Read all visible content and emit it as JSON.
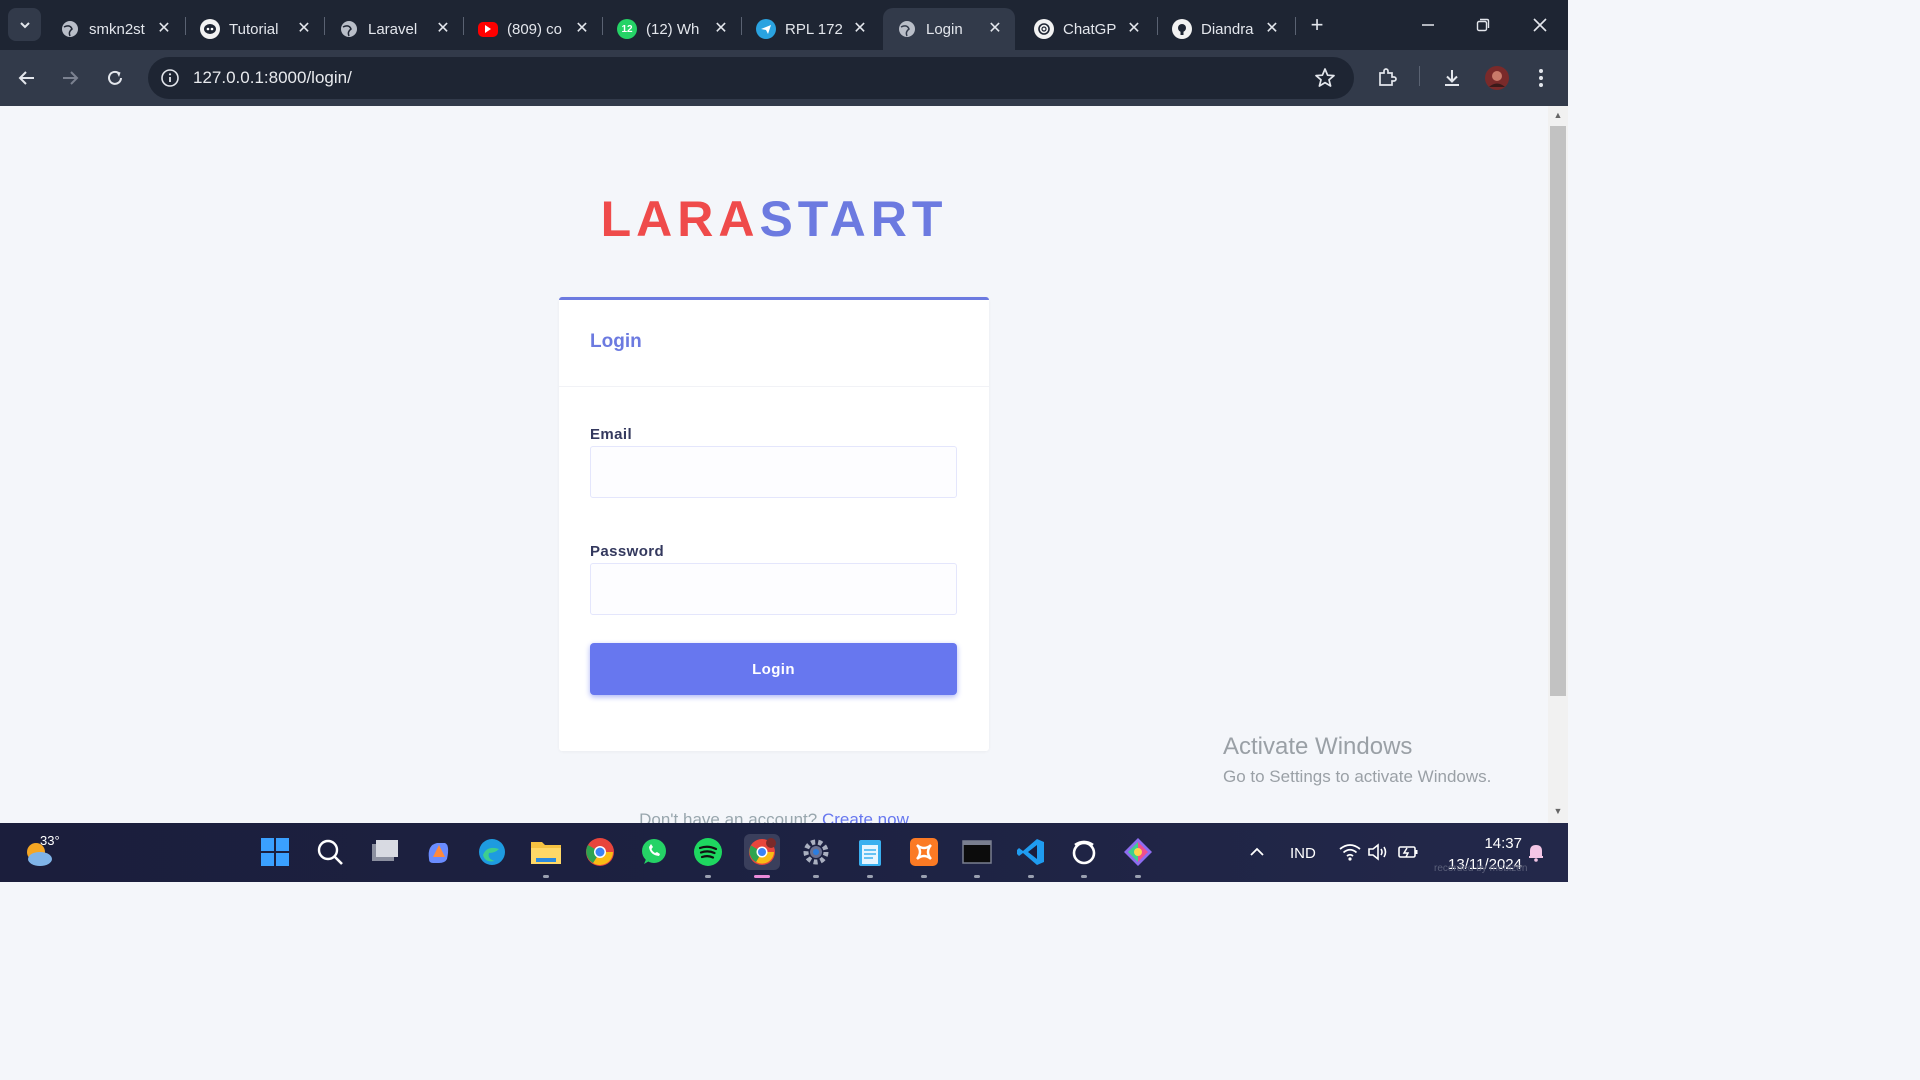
{
  "browser": {
    "tabs": [
      {
        "title": "smkn2st",
        "favicon": "globe-icon"
      },
      {
        "title": "Tutorial",
        "favicon": "alien-icon"
      },
      {
        "title": "Laravel",
        "favicon": "globe-icon"
      },
      {
        "title": "(809) co",
        "favicon": "youtube-icon"
      },
      {
        "title": "(12) Wh",
        "favicon": "whatsapp-icon",
        "badge": "12"
      },
      {
        "title": "RPL 172",
        "favicon": "telegram-icon"
      },
      {
        "title": "Login",
        "favicon": "globe-icon",
        "active": true
      },
      {
        "title": "ChatGP",
        "favicon": "openai-icon"
      },
      {
        "title": "Diandra",
        "favicon": "github-icon"
      }
    ],
    "address": "127.0.0.1:8000/login/"
  },
  "page": {
    "brand_part1": "LARA",
    "brand_part2": "START",
    "card_title": "Login",
    "email_label": "Email",
    "email_value": "",
    "password_label": "Password",
    "password_value": "",
    "login_button": "Login",
    "signup_text": "Don't have an account?",
    "signup_link": "Create now"
  },
  "watermark": {
    "line1": "Activate Windows",
    "line2": "Go to Settings to activate Windows."
  },
  "taskbar": {
    "weather_temp": "33°",
    "language": "IND",
    "time": "14:37",
    "date": "13/11/2024",
    "recorded": "recorded by mobizen"
  },
  "colors": {
    "brand_red": "#ef4b4b",
    "brand_blue": "#6c7ae0",
    "button": "#6777ef",
    "chrome_dark": "#1e2533",
    "chrome_mid": "#323a4a"
  }
}
